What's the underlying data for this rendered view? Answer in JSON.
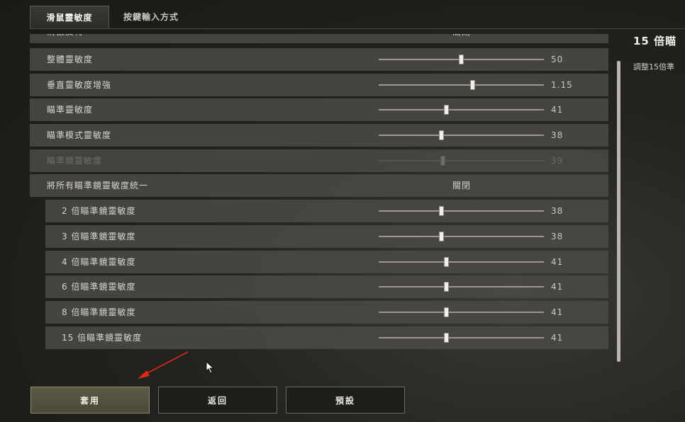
{
  "tabs": [
    {
      "label": "滑鼠靈敏度",
      "active": true
    },
    {
      "label": "按鍵輸入方式",
      "active": false
    }
  ],
  "settings": [
    {
      "label": "滑鼠反轉",
      "kind": "toggle",
      "value": "關閉",
      "slider_fraction": null,
      "disabled": false,
      "sub": false
    },
    {
      "label": "整體靈敏度",
      "kind": "slider",
      "value": "50",
      "slider_fraction": 0.5,
      "disabled": false,
      "sub": false
    },
    {
      "label": "垂直靈敏度增強",
      "kind": "slider",
      "value": "1.15",
      "slider_fraction": 0.57,
      "disabled": false,
      "sub": false
    },
    {
      "label": "瞄準靈敏度",
      "kind": "slider",
      "value": "41",
      "slider_fraction": 0.41,
      "disabled": false,
      "sub": false
    },
    {
      "label": "瞄準模式靈敏度",
      "kind": "slider",
      "value": "38",
      "slider_fraction": 0.38,
      "disabled": false,
      "sub": false
    },
    {
      "label": "瞄準鏡靈敏度",
      "kind": "slider",
      "value": "39",
      "slider_fraction": 0.39,
      "disabled": true,
      "sub": false
    },
    {
      "label": "將所有瞄準鏡靈敏度統一",
      "kind": "toggle",
      "value": "關閉",
      "slider_fraction": null,
      "disabled": false,
      "sub": false
    },
    {
      "label": "2 倍瞄準鏡靈敏度",
      "kind": "slider",
      "value": "38",
      "slider_fraction": 0.38,
      "disabled": false,
      "sub": true
    },
    {
      "label": "3 倍瞄準鏡靈敏度",
      "kind": "slider",
      "value": "38",
      "slider_fraction": 0.38,
      "disabled": false,
      "sub": true
    },
    {
      "label": "4 倍瞄準鏡靈敏度",
      "kind": "slider",
      "value": "41",
      "slider_fraction": 0.41,
      "disabled": false,
      "sub": true
    },
    {
      "label": "6 倍瞄準鏡靈敏度",
      "kind": "slider",
      "value": "41",
      "slider_fraction": 0.41,
      "disabled": false,
      "sub": true
    },
    {
      "label": "8 倍瞄準鏡靈敏度",
      "kind": "slider",
      "value": "41",
      "slider_fraction": 0.41,
      "disabled": false,
      "sub": true
    },
    {
      "label": "15 倍瞄準鏡靈敏度",
      "kind": "slider",
      "value": "41",
      "slider_fraction": 0.41,
      "disabled": false,
      "sub": true
    }
  ],
  "help": {
    "title": "15 倍瞄",
    "description": "調整15倍準"
  },
  "footer": {
    "apply_label": "套用",
    "back_label": "返回",
    "default_label": "預設"
  },
  "icons": {
    "cursor": "mouse-pointer-icon",
    "annotation": "red-arrow-icon"
  },
  "colors": {
    "row_bg": "#4a4944",
    "primary_button": "#5d5a46",
    "annotation_arrow": "#e0261b"
  }
}
